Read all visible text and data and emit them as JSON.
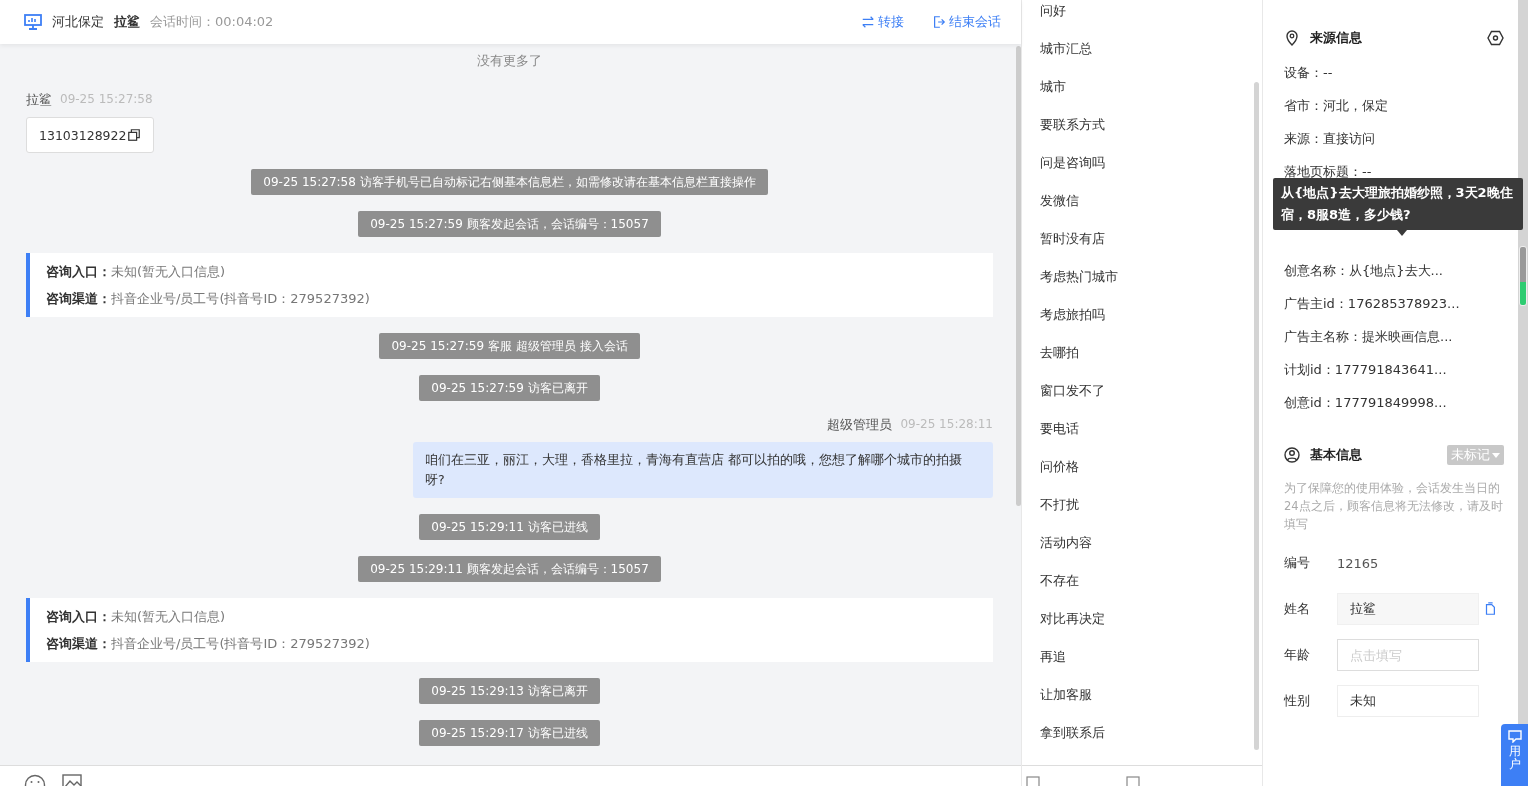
{
  "header": {
    "location": "河北保定",
    "visitor": "拉鲨",
    "duration": "会话时间：00:04:02",
    "actions": [
      {
        "kind": "transfer",
        "label": "转接"
      },
      {
        "kind": "end",
        "label": "结束会话"
      }
    ]
  },
  "chat": {
    "no_more": "没有更多了",
    "items": [
      {
        "kind": "visitor",
        "name": "拉鲨",
        "time": "09-25 15:27:58",
        "text": "13103128922"
      },
      {
        "kind": "notice",
        "text": "09-25 15:27:58 访客手机号已自动标记右侧基本信息栏，如需修改请在基本信息栏直接操作"
      },
      {
        "kind": "notice",
        "text": "09-25 15:27:59 顾客发起会话，会话编号：15057"
      },
      {
        "kind": "entry",
        "lines": [
          {
            "label": "咨询入口：",
            "value": "未知(暂无入口信息)"
          },
          {
            "label": "咨询渠道：",
            "value": "抖音企业号/员工号(抖音号ID：279527392)"
          }
        ]
      },
      {
        "kind": "notice",
        "text": "09-25 15:27:59 客服 超级管理员 接入会话"
      },
      {
        "kind": "notice",
        "text": "09-25 15:27:59 访客已离开"
      },
      {
        "kind": "agent",
        "name": "超级管理员",
        "time": "09-25 15:28:11",
        "text": "咱们在三亚，丽江，大理，香格里拉，青海有直营店 都可以拍的哦，您想了解哪个城市的拍摄呀?"
      },
      {
        "kind": "notice",
        "text": "09-25 15:29:11 访客已进线"
      },
      {
        "kind": "notice",
        "text": "09-25 15:29:11 顾客发起会话，会话编号：15057"
      },
      {
        "kind": "entry",
        "lines": [
          {
            "label": "咨询入口：",
            "value": "未知(暂无入口信息)"
          },
          {
            "label": "咨询渠道：",
            "value": "抖音企业号/员工号(抖音号ID：279527392)"
          }
        ]
      },
      {
        "kind": "notice",
        "text": "09-25 15:29:13 访客已离开"
      },
      {
        "kind": "notice",
        "text": "09-25 15:29:17 访客已进线"
      }
    ]
  },
  "quick_replies": [
    "问好",
    "城市汇总",
    "城市",
    "要联系方式",
    "问是咨询吗",
    "发微信",
    "暂时没有店",
    "考虑热门城市",
    "考虑旅拍吗",
    "去哪拍",
    "窗口发不了",
    "要电话",
    "问价格",
    "不打扰",
    "活动内容",
    "不存在",
    "对比再决定",
    "再追",
    "让加客服",
    "拿到联系后"
  ],
  "source_info": {
    "title": "来源信息",
    "rows_above": [
      "设备：--",
      "省市：河北，保定",
      "来源：直接访问",
      "落地页标题：--"
    ],
    "tooltip": "从{地点}去大理旅拍婚纱照，3天2晚住宿，8服8造，多少钱?",
    "rows_below": [
      "创意名称：从{地点}去大...",
      "广告主id：176285378923...",
      "广告主名称：提米映画信息...",
      "计划id：177791843641...",
      "创意id：177791849998..."
    ]
  },
  "basic_info": {
    "title": "基本信息",
    "tag": "未标记",
    "notice": "为了保障您的使用体验，会话发生当日的24点之后，顾客信息将无法修改，请及时填写",
    "fields": [
      {
        "kind": "text",
        "label": "编号",
        "value": "12165"
      },
      {
        "kind": "filled",
        "label": "姓名",
        "value": "拉鲨"
      },
      {
        "kind": "input",
        "label": "年龄",
        "placeholder": "点击填写"
      },
      {
        "kind": "select",
        "label": "性别",
        "value": "未知"
      }
    ]
  },
  "float_button": {
    "label": "用户"
  }
}
